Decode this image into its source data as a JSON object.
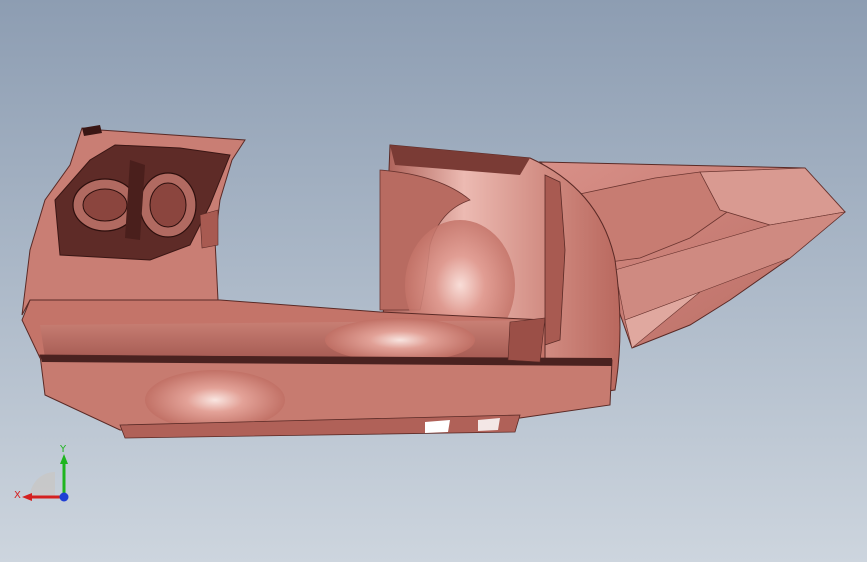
{
  "viewport": {
    "background_top": "#8d9db2",
    "background_bottom": "#cdd5de",
    "model_color": "#c97e74",
    "model_shadow": "#7a3f39",
    "model_highlight": "#f5d6cf"
  },
  "triad": {
    "x_label": "X",
    "y_label": "Y",
    "x_color": "#d42020",
    "y_color": "#1fb51f",
    "z_color": "#1f3fd4"
  }
}
